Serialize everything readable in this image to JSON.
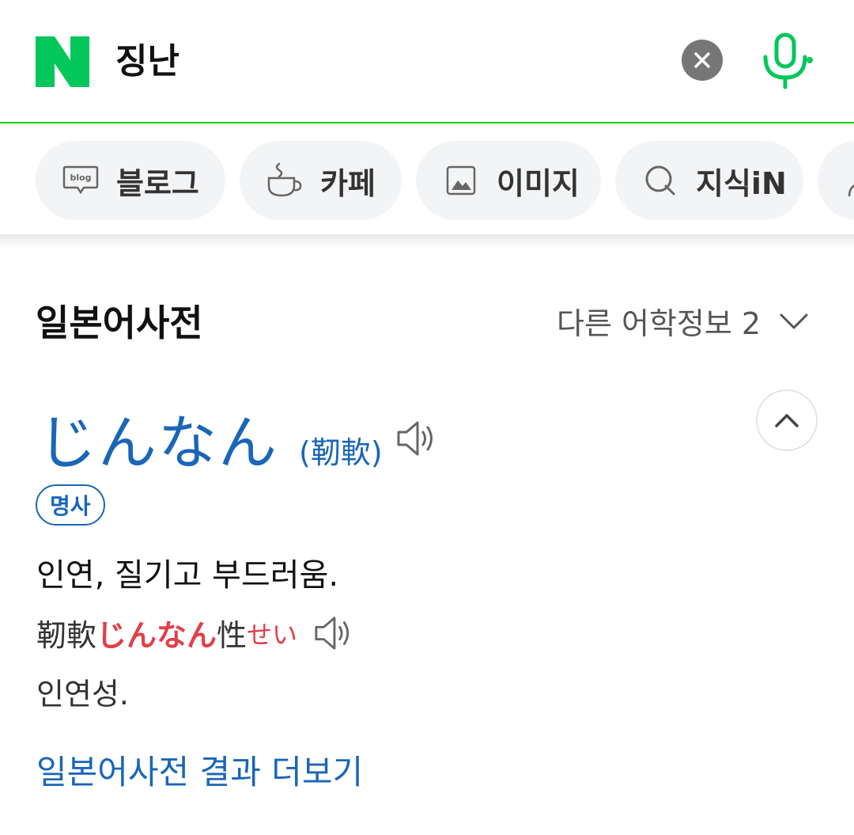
{
  "search": {
    "query": "징난"
  },
  "colors": {
    "brand_green": "#03C75A",
    "link_blue": "#1A66B8",
    "highlight_red": "#E0404A"
  },
  "tabs": [
    {
      "label": "블로그",
      "icon": "blog-icon"
    },
    {
      "label": "카페",
      "icon": "cafe-cup-icon"
    },
    {
      "label": "이미지",
      "icon": "image-icon"
    },
    {
      "label": "지식iN",
      "icon": "kin-search-icon"
    },
    {
      "label": "",
      "icon": "person-icon"
    }
  ],
  "dictionary": {
    "title": "일본어사전",
    "more_info_label": "다른 어학정보 2",
    "entry": {
      "kana": "じんなん",
      "kanji": "(靭軟)",
      "part_of_speech": "명사",
      "meaning": "인연, 질기고 부드러움.",
      "example": {
        "prefix": "靭軟",
        "highlight": "じんなん",
        "suffix": "性",
        "reading": "せい",
        "translation": "인연성."
      }
    },
    "more_link": "일본어사전 결과 더보기"
  }
}
